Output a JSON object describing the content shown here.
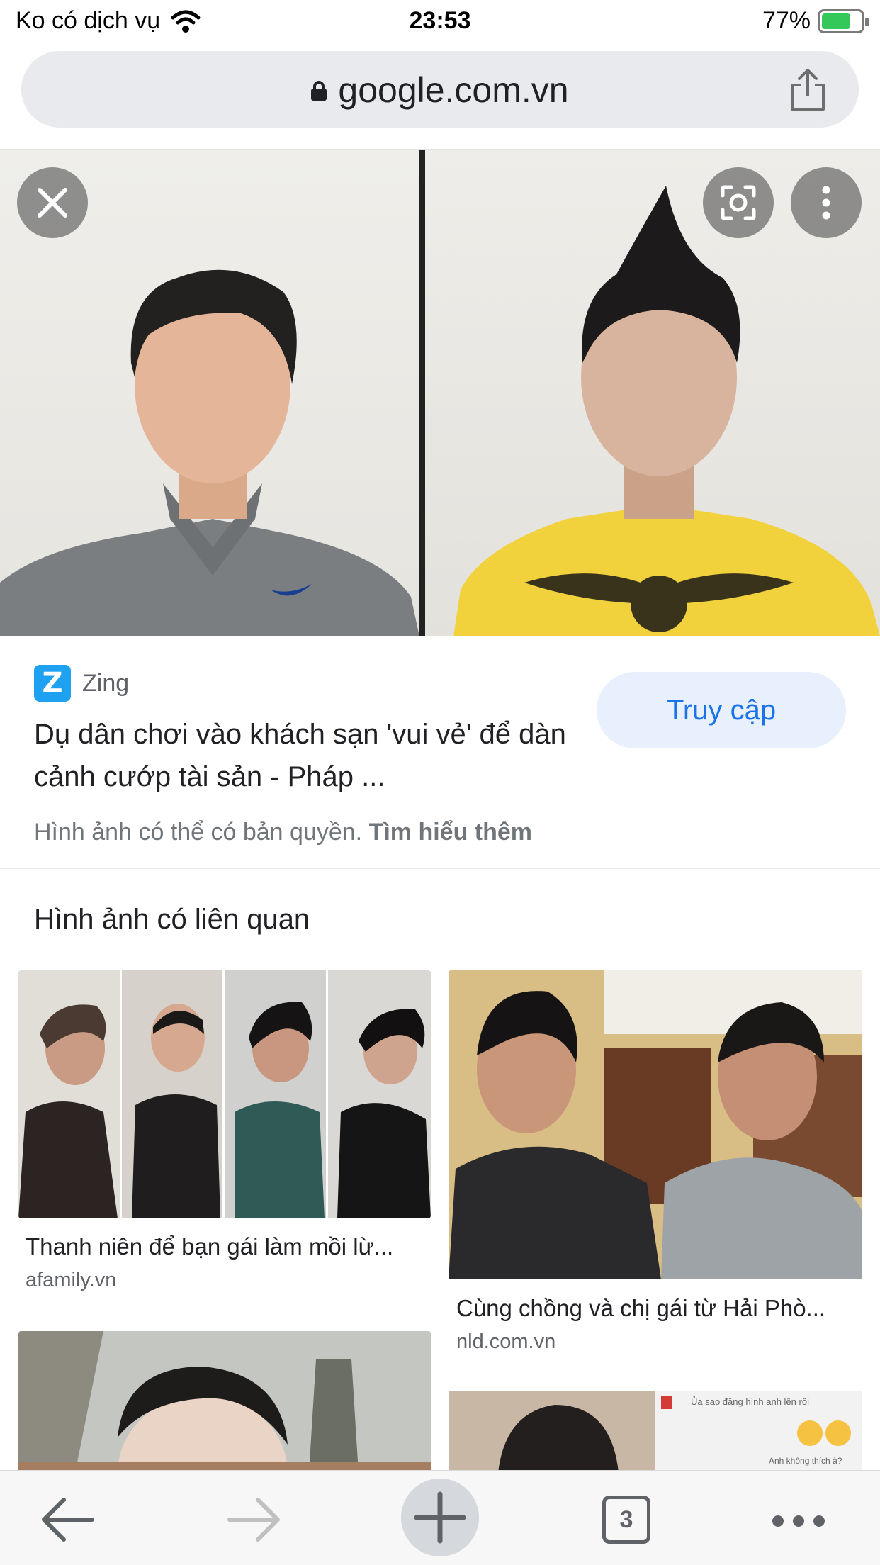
{
  "status_bar": {
    "carrier": "Ko có dịch vụ",
    "time": "23:53",
    "battery": "77%",
    "battery_level": 0.77,
    "charging": true
  },
  "url_bar": {
    "url": "google.com.vn",
    "secure": true,
    "share_icon": "share-icon"
  },
  "image_viewer": {
    "icons": [
      "close-icon",
      "lens-icon",
      "more-vert-icon"
    ]
  },
  "result": {
    "source_logo_letter": "Z",
    "source_name": "Zing",
    "title": "Dụ dân chơi vào khách sạn 'vui vẻ' để dàn cảnh cướp tài sản - Pháp ...",
    "visit_label": "Truy cập",
    "copyright_text": "Hình ảnh có thể có bản quyền.",
    "learn_more": "Tìm hiểu thêm"
  },
  "related": {
    "heading": "Hình ảnh có liên quan",
    "items": [
      {
        "caption": "Thanh niên để bạn gái làm mồi lừ...",
        "source": "afamily.vn"
      },
      {
        "caption": "Cùng chồng và chị gái từ Hải Phò...",
        "source": "nld.com.vn"
      }
    ],
    "thumb4_chat_lines": [
      "Ủa sao đăng hình anh lên rồi",
      "Anh không thích à?"
    ]
  },
  "toolbar": {
    "tab_count": "3",
    "icons": [
      "back-arrow-icon",
      "forward-arrow-icon",
      "plus-icon",
      "tabs-icon",
      "more-horiz-icon"
    ]
  },
  "colors": {
    "accent": "#1a73e8",
    "button_bg": "#e8f0fe",
    "zing_brand": "#1ea1f1",
    "battery_green": "#34c759"
  }
}
